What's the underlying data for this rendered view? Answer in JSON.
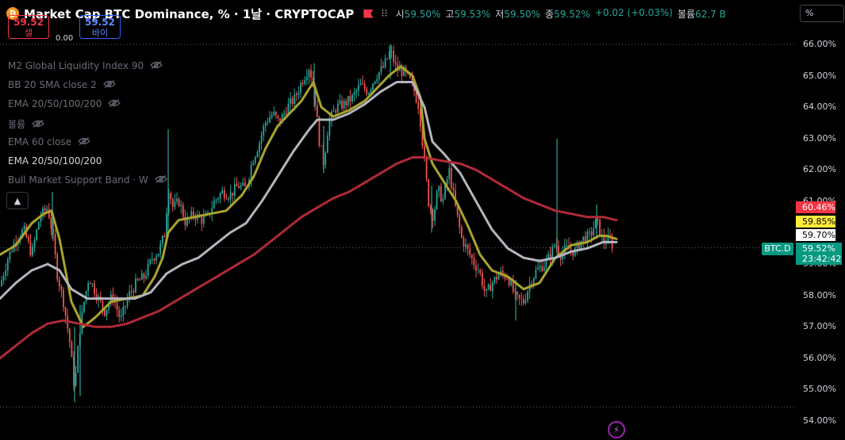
{
  "header": {
    "logo": "₿",
    "title": "Market Cap BTC Dominance, % · 1날 · CRYPTOCAP",
    "more": "⁝⁝",
    "ohlc": [
      {
        "k": "시",
        "v": "59.50%"
      },
      {
        "k": "고",
        "v": "59.53%"
      },
      {
        "k": "저",
        "v": "59.50%"
      },
      {
        "k": "종",
        "v": "59.52%"
      }
    ],
    "change": "+0.02 (+0.03%)",
    "volume_label": "볼륨",
    "volume_value": "62.7 B"
  },
  "trade": {
    "sell_price": "59.52",
    "sell_label": "셀",
    "spread": "0.00",
    "buy_price": "59.52",
    "buy_label": "바이"
  },
  "indicators": [
    {
      "label": "M2 Global Liquidity Index 90",
      "hidden": true
    },
    {
      "label": "BB 20 SMA close 2",
      "hidden": true
    },
    {
      "label": "EMA 20/50/100/200",
      "hidden": true
    },
    {
      "label": "볼륨",
      "hidden": true
    },
    {
      "label": "EMA 60 close",
      "hidden": true
    },
    {
      "label": "EMA 20/50/100/200",
      "hidden": false
    },
    {
      "label": "Bull Market Support Band · W",
      "hidden": true
    }
  ],
  "scale_button": "%",
  "collapse_icon": "chevron-up-icon",
  "badges": {
    "red": {
      "text": "60.46%",
      "color": "#f23645"
    },
    "yellow": {
      "text": "59.85%",
      "color": "#ffeb3b"
    },
    "white": {
      "text": "59.70%",
      "color": "#ffffff"
    },
    "last": {
      "text": "59.52%",
      "countdown": "23:42:42",
      "symbol": "BTC.D",
      "color": "#089981"
    }
  },
  "chart_data": {
    "type": "candlestick",
    "ylim": [
      54.0,
      66.0
    ],
    "yticks": [
      "66.00%",
      "65.00%",
      "64.00%",
      "63.00%",
      "62.00%",
      "61.00%",
      "60.00%",
      "59.00%",
      "58.00%",
      "57.00%",
      "56.00%",
      "55.00%",
      "54.00%"
    ],
    "close_path": [
      [
        0,
        58.3
      ],
      [
        10,
        59.2
      ],
      [
        20,
        59.8
      ],
      [
        30,
        60.1
      ],
      [
        40,
        59.3
      ],
      [
        50,
        60.5
      ],
      [
        60,
        60.8
      ],
      [
        66,
        60.0
      ],
      [
        72,
        58.7
      ],
      [
        80,
        57.8
      ],
      [
        88,
        56.5
      ],
      [
        94,
        55.0
      ],
      [
        100,
        56.8
      ],
      [
        106,
        57.8
      ],
      [
        112,
        58.6
      ],
      [
        122,
        58.0
      ],
      [
        132,
        57.5
      ],
      [
        142,
        58.0
      ],
      [
        152,
        57.2
      ],
      [
        162,
        58.0
      ],
      [
        172,
        58.4
      ],
      [
        182,
        58.6
      ],
      [
        192,
        59.2
      ],
      [
        200,
        59.4
      ],
      [
        208,
        60.0
      ],
      [
        212,
        61.5
      ],
      [
        218,
        60.8
      ],
      [
        226,
        61.0
      ],
      [
        234,
        60.3
      ],
      [
        244,
        60.6
      ],
      [
        254,
        60.4
      ],
      [
        262,
        60.5
      ],
      [
        270,
        61.0
      ],
      [
        280,
        61.3
      ],
      [
        290,
        61.2
      ],
      [
        300,
        61.5
      ],
      [
        310,
        61.4
      ],
      [
        318,
        62.3
      ],
      [
        326,
        62.8
      ],
      [
        334,
        63.5
      ],
      [
        344,
        63.8
      ],
      [
        352,
        63.5
      ],
      [
        362,
        64.0
      ],
      [
        372,
        64.3
      ],
      [
        380,
        64.8
      ],
      [
        390,
        65.3
      ],
      [
        396,
        64.5
      ],
      [
        402,
        63.0
      ],
      [
        408,
        62.2
      ],
      [
        414,
        63.5
      ],
      [
        424,
        64.0
      ],
      [
        434,
        64.1
      ],
      [
        444,
        64.3
      ],
      [
        454,
        64.7
      ],
      [
        464,
        64.5
      ],
      [
        474,
        65.0
      ],
      [
        484,
        65.3
      ],
      [
        492,
        65.8
      ],
      [
        500,
        65.2
      ],
      [
        510,
        65.1
      ],
      [
        520,
        64.7
      ],
      [
        528,
        64.0
      ],
      [
        534,
        62.5
      ],
      [
        540,
        61.0
      ],
      [
        546,
        60.5
      ],
      [
        552,
        61.4
      ],
      [
        558,
        61.0
      ],
      [
        566,
        62.0
      ],
      [
        574,
        60.8
      ],
      [
        582,
        59.8
      ],
      [
        590,
        59.4
      ],
      [
        598,
        59.0
      ],
      [
        604,
        58.8
      ],
      [
        612,
        58.0
      ],
      [
        620,
        58.4
      ],
      [
        630,
        58.7
      ],
      [
        640,
        58.6
      ],
      [
        650,
        57.9
      ],
      [
        660,
        57.8
      ],
      [
        668,
        58.4
      ],
      [
        676,
        58.8
      ],
      [
        686,
        59.0
      ],
      [
        694,
        59.3
      ],
      [
        700,
        59.7
      ],
      [
        706,
        59.3
      ],
      [
        714,
        59.5
      ],
      [
        724,
        59.4
      ],
      [
        734,
        59.8
      ],
      [
        744,
        59.9
      ],
      [
        752,
        60.4
      ],
      [
        760,
        59.7
      ],
      [
        768,
        59.8
      ],
      [
        774,
        59.5
      ]
    ],
    "spikes": [
      {
        "x": 66,
        "hi": 61.3,
        "lo": 59.8
      },
      {
        "x": 94,
        "hi": 57.0,
        "lo": 54.6
      },
      {
        "x": 101,
        "hi": 57.7,
        "lo": 54.8
      },
      {
        "x": 212,
        "hi": 63.3,
        "lo": 59.9
      },
      {
        "x": 396,
        "hi": 65.4,
        "lo": 64.0
      },
      {
        "x": 408,
        "hi": 63.4,
        "lo": 61.9
      },
      {
        "x": 492,
        "hi": 66.0,
        "lo": 64.9
      },
      {
        "x": 544,
        "hi": 61.5,
        "lo": 60.0
      },
      {
        "x": 650,
        "hi": 58.5,
        "lo": 57.2
      },
      {
        "x": 702,
        "hi": 63.0,
        "lo": 59.3
      },
      {
        "x": 752,
        "hi": 60.9,
        "lo": 59.8
      }
    ],
    "series": [
      {
        "color": "#a9a42c",
        "width": 3,
        "points": [
          [
            0,
            59.3
          ],
          [
            20,
            59.6
          ],
          [
            40,
            60.3
          ],
          [
            55,
            60.6
          ],
          [
            65,
            60.7
          ],
          [
            75,
            59.8
          ],
          [
            90,
            57.8
          ],
          [
            105,
            57.0
          ],
          [
            120,
            57.3
          ],
          [
            140,
            57.8
          ],
          [
            160,
            57.9
          ],
          [
            180,
            58.0
          ],
          [
            195,
            58.6
          ],
          [
            205,
            59.2
          ],
          [
            212,
            60.0
          ],
          [
            225,
            60.4
          ],
          [
            245,
            60.5
          ],
          [
            265,
            60.6
          ],
          [
            285,
            60.7
          ],
          [
            305,
            61.2
          ],
          [
            320,
            61.8
          ],
          [
            335,
            62.7
          ],
          [
            350,
            63.4
          ],
          [
            365,
            63.8
          ],
          [
            380,
            64.2
          ],
          [
            395,
            64.8
          ],
          [
            405,
            64.0
          ],
          [
            420,
            63.7
          ],
          [
            440,
            63.9
          ],
          [
            460,
            64.2
          ],
          [
            475,
            64.6
          ],
          [
            490,
            65.0
          ],
          [
            505,
            65.3
          ],
          [
            520,
            65.0
          ],
          [
            530,
            64.3
          ],
          [
            535,
            63.0
          ],
          [
            545,
            62.2
          ],
          [
            560,
            61.6
          ],
          [
            575,
            61.0
          ],
          [
            590,
            60.2
          ],
          [
            605,
            59.3
          ],
          [
            620,
            58.8
          ],
          [
            640,
            58.6
          ],
          [
            660,
            58.2
          ],
          [
            680,
            58.4
          ],
          [
            700,
            59.2
          ],
          [
            720,
            59.6
          ],
          [
            740,
            59.7
          ],
          [
            755,
            59.9
          ],
          [
            765,
            59.9
          ],
          [
            777,
            59.8
          ]
        ]
      },
      {
        "color": "#b2b5be",
        "width": 3,
        "points": [
          [
            0,
            57.9
          ],
          [
            20,
            58.4
          ],
          [
            40,
            58.8
          ],
          [
            60,
            59.0
          ],
          [
            75,
            58.8
          ],
          [
            90,
            58.2
          ],
          [
            110,
            57.9
          ],
          [
            130,
            57.9
          ],
          [
            150,
            57.9
          ],
          [
            170,
            57.9
          ],
          [
            190,
            58.1
          ],
          [
            210,
            58.7
          ],
          [
            230,
            59.0
          ],
          [
            250,
            59.2
          ],
          [
            270,
            59.6
          ],
          [
            290,
            60.0
          ],
          [
            310,
            60.3
          ],
          [
            330,
            61.0
          ],
          [
            350,
            61.8
          ],
          [
            370,
            62.6
          ],
          [
            390,
            63.3
          ],
          [
            400,
            63.6
          ],
          [
            420,
            63.6
          ],
          [
            440,
            63.8
          ],
          [
            460,
            64.1
          ],
          [
            480,
            64.5
          ],
          [
            500,
            64.8
          ],
          [
            520,
            64.8
          ],
          [
            535,
            64.0
          ],
          [
            545,
            62.9
          ],
          [
            560,
            62.5
          ],
          [
            580,
            61.9
          ],
          [
            600,
            61.0
          ],
          [
            620,
            60.1
          ],
          [
            640,
            59.5
          ],
          [
            660,
            59.2
          ],
          [
            680,
            59.1
          ],
          [
            700,
            59.2
          ],
          [
            720,
            59.4
          ],
          [
            740,
            59.5
          ],
          [
            760,
            59.7
          ],
          [
            777,
            59.7
          ]
        ]
      },
      {
        "color": "#b02a37",
        "width": 3,
        "points": [
          [
            0,
            56.0
          ],
          [
            20,
            56.4
          ],
          [
            40,
            56.8
          ],
          [
            60,
            57.1
          ],
          [
            80,
            57.2
          ],
          [
            100,
            57.1
          ],
          [
            120,
            57.0
          ],
          [
            140,
            57.0
          ],
          [
            160,
            57.1
          ],
          [
            180,
            57.3
          ],
          [
            200,
            57.5
          ],
          [
            220,
            57.8
          ],
          [
            240,
            58.1
          ],
          [
            260,
            58.4
          ],
          [
            280,
            58.7
          ],
          [
            300,
            59.0
          ],
          [
            320,
            59.3
          ],
          [
            340,
            59.7
          ],
          [
            360,
            60.1
          ],
          [
            380,
            60.5
          ],
          [
            400,
            60.8
          ],
          [
            420,
            61.1
          ],
          [
            440,
            61.3
          ],
          [
            460,
            61.6
          ],
          [
            480,
            61.9
          ],
          [
            500,
            62.2
          ],
          [
            520,
            62.4
          ],
          [
            535,
            62.4
          ],
          [
            555,
            62.3
          ],
          [
            580,
            62.2
          ],
          [
            600,
            62.0
          ],
          [
            620,
            61.7
          ],
          [
            640,
            61.4
          ],
          [
            660,
            61.1
          ],
          [
            680,
            60.9
          ],
          [
            700,
            60.7
          ],
          [
            720,
            60.6
          ],
          [
            740,
            60.5
          ],
          [
            760,
            60.5
          ],
          [
            777,
            60.4
          ]
        ]
      }
    ],
    "dotted_levels": [
      66.0,
      59.52,
      54.45
    ]
  }
}
